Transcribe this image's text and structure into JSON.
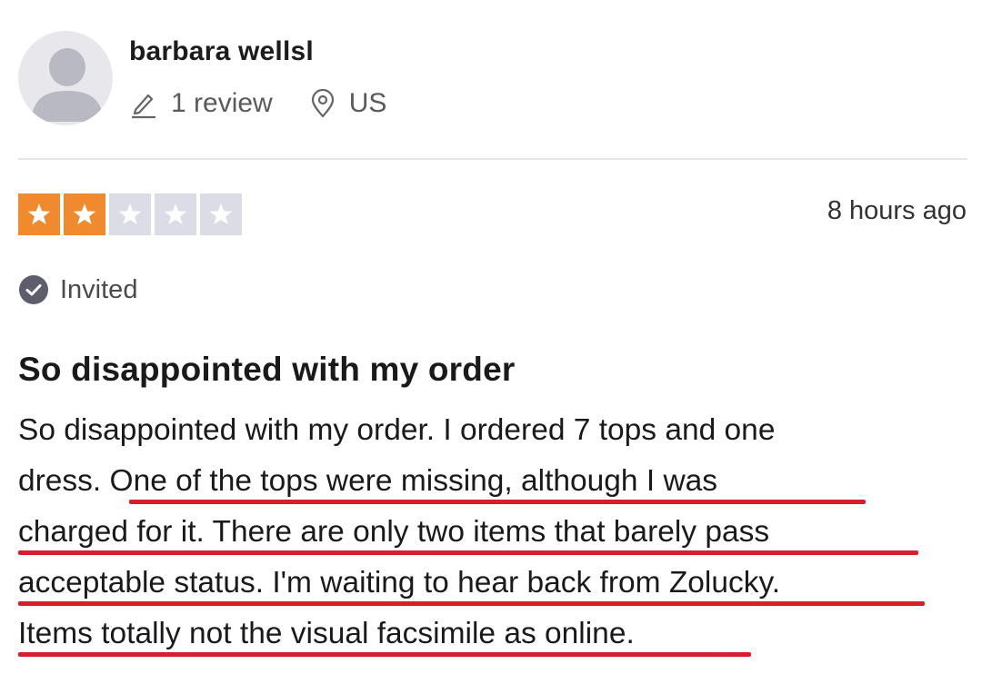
{
  "consumer": {
    "name": "barbara wellsl",
    "review_count": "1 review",
    "country": "US"
  },
  "review": {
    "rating": 2,
    "rating_max": 5,
    "date": "8 hours ago",
    "verification_label": "Invited",
    "title": "So disappointed with my order",
    "body_lines": [
      {
        "a": "So disappointed with my order. I ordered 7 tops and one",
        "b": ""
      },
      {
        "a": "dress. ",
        "b": "One of the tops were missing, although I was"
      },
      {
        "a": "",
        "b": "charged for it. There are only two items that barely pass"
      },
      {
        "a": "",
        "b": "acceptable status. I'm waiting to hear back from Zolucky."
      },
      {
        "a": "",
        "b": "Items totally not the visual facsimile as online."
      }
    ]
  },
  "colors": {
    "star_filled": "#f08a2e",
    "star_empty": "#dcdce6",
    "annotation_underline": "#d81e2a",
    "divider": "#e4e4ec"
  },
  "icons": {
    "avatar": "person-silhouette-icon",
    "reviews": "pencil-icon",
    "location": "location-pin-icon",
    "star": "star-icon",
    "invited": "checkmark-circle-icon"
  }
}
